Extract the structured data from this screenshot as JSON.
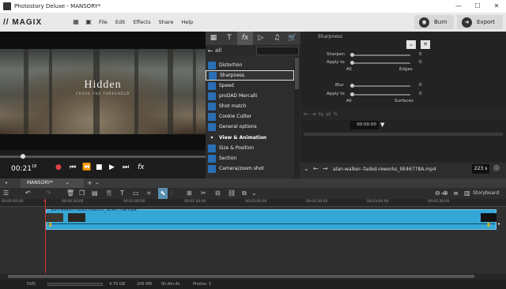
{
  "window": {
    "title": "Photostory Deluxe - MANSORY*",
    "min": "—",
    "max": "☐",
    "close": "✕"
  },
  "menubar": {
    "logo": "// MAGIX",
    "items": [
      "File",
      "Edit",
      "Effects",
      "Share",
      "Help"
    ],
    "burn": "Burn",
    "export": "Export"
  },
  "preview": {
    "title": "Hidden",
    "subtitle": "CROSS THE THRESHOLD",
    "timecode": "00:21",
    "frames": "18"
  },
  "effects": {
    "tabs": [
      "T",
      "fx",
      "▷",
      "♫",
      "🛒"
    ],
    "back": "←",
    "filter": "all",
    "items": [
      {
        "label": "Distortion",
        "group": false
      },
      {
        "label": "Sharpness",
        "group": false,
        "selected": true
      },
      {
        "label": "Speed",
        "group": false
      },
      {
        "label": "proDAD Mercalli",
        "group": false
      },
      {
        "label": "Shot match",
        "group": false
      },
      {
        "label": "Cookie Cutter",
        "group": false
      },
      {
        "label": "General options",
        "group": false
      },
      {
        "label": "View & Animation",
        "group": true
      },
      {
        "label": "Size & Position",
        "group": false
      },
      {
        "label": "Section",
        "group": false
      },
      {
        "label": "Camera/zoom shot",
        "group": false
      }
    ]
  },
  "properties": {
    "heading": "Sharpness",
    "sharpen_label": "Sharpen",
    "sharpen_value": "0",
    "apply_to_label": "Apply to",
    "apply_to_value_1": "0",
    "all_1": "All",
    "edges": "Edges",
    "blur_label": "Blur",
    "blur_value": "0",
    "apply_to_value_2": "0",
    "all_2": "All",
    "surfaces": "Surfaces",
    "keyframe_time": "00:00:00",
    "file_name": "alan-walker--faded-reworks_9E46778A.mp4",
    "file_duration": "223 s"
  },
  "timeline": {
    "tab": "MANSORY*",
    "storyboard": "Storyboard",
    "ruler": [
      "00:00:00:00",
      "00:00:30:00",
      "00:01:00:00",
      "00:01:30:00",
      "00:02:00:00",
      "00:02:30:00",
      "00:03:00:00",
      "00:03:30:00"
    ],
    "clip_name": "alan-walker--faded-reworks_9E46778A.mp4"
  },
  "status": {
    "format": "DVD",
    "size_gb": "4.70 GB",
    "size_mb": "206 MB",
    "duration": "0h:4m:4s",
    "photos": "Photos: 1"
  }
}
